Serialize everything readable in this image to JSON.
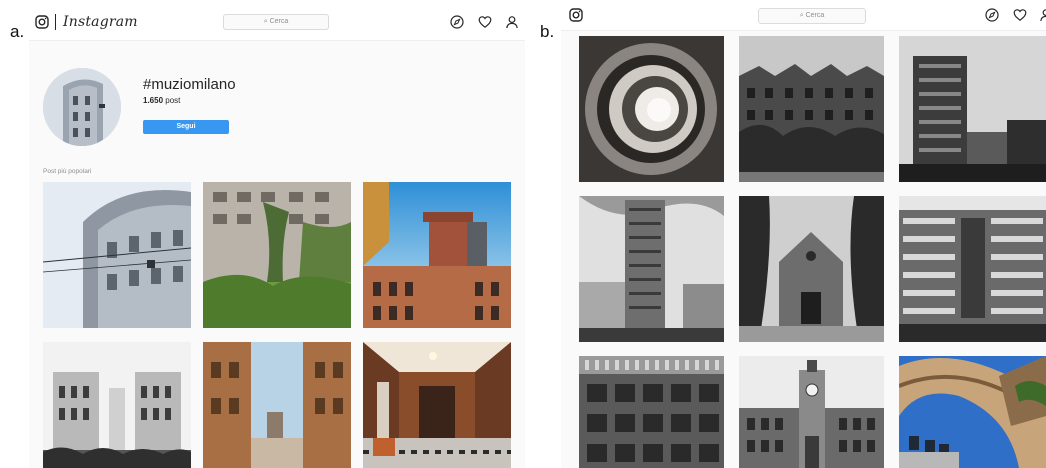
{
  "labels": {
    "panel_a": "a.",
    "panel_b": "b."
  },
  "panel_a": {
    "nav": {
      "logo_icon": "instagram-camera-icon",
      "wordmark": "Instagram",
      "search_placeholder": "Cerca",
      "icons": [
        "explore-compass-icon",
        "heart-icon",
        "profile-icon"
      ]
    },
    "profile": {
      "hashtag": "#muziomilano",
      "post_count": "1.650",
      "post_word": "post",
      "follow_label": "Segui"
    },
    "section_title": "Post più popolari",
    "posts": [
      "curved-facade-photo",
      "ivy-building-photo",
      "tower-sunset-photo",
      "symmetric-buildings-bw-photo",
      "street-canyon-photo",
      "museum-gallery-photo"
    ]
  },
  "panel_b": {
    "nav": {
      "logo_icon": "instagram-camera-icon",
      "search_placeholder": "Cerca",
      "icons": [
        "explore-compass-icon",
        "heart-icon",
        "profile-icon"
      ]
    },
    "posts": [
      "spiral-staircase-photo",
      "brick-apartment-block-photo",
      "tower-block-photo",
      "skyscraper-photo",
      "church-facade-photo",
      "balcony-building-photo",
      "grid-facade-photo",
      "clock-tower-photo",
      "arch-passage-photo"
    ]
  },
  "colors": {
    "accent_button": "#3897f0",
    "text": "#262626",
    "muted": "#8e8e8e",
    "page_bg": "#fafafa"
  }
}
